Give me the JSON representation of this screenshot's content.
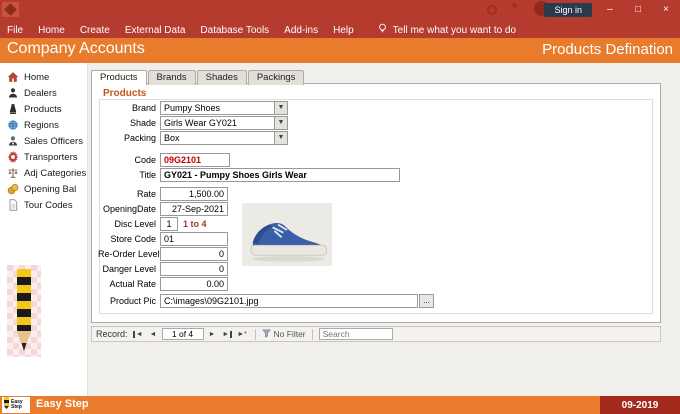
{
  "colors": {
    "titlebar": "#b43b2d",
    "accent_orange": "#e87c2c",
    "dark_red": "#a32b1d",
    "code_red": "#c00000"
  },
  "titlebar": {
    "menus": [
      "File",
      "Home",
      "Create",
      "External Data",
      "Database Tools",
      "Add-ins",
      "Help"
    ],
    "tell_me": "Tell me what you want to do",
    "sign_in": "Sign in",
    "controls": {
      "minimize": "–",
      "maximize": "□",
      "close": "×"
    }
  },
  "header": {
    "title": "Company Accounts",
    "subtitle": "Products Defination"
  },
  "sidebar": {
    "items": [
      {
        "label": "Home"
      },
      {
        "label": "Dealers"
      },
      {
        "label": "Products"
      },
      {
        "label": "Regions"
      },
      {
        "label": "Sales Officers"
      },
      {
        "label": "Transporters"
      },
      {
        "label": "Adj Categories"
      },
      {
        "label": "Opening Bal"
      },
      {
        "label": "Tour Codes"
      }
    ]
  },
  "tabs": [
    {
      "label": "Products"
    },
    {
      "label": "Brands"
    },
    {
      "label": "Shades"
    },
    {
      "label": "Packings"
    }
  ],
  "form": {
    "section_title": "Products",
    "fields": {
      "brand": {
        "label": "Brand",
        "value": "Pumpy Shoes"
      },
      "shade": {
        "label": "Shade",
        "value": "Girls Wear GY021"
      },
      "packing": {
        "label": "Packing",
        "value": "Box"
      },
      "code": {
        "label": "Code",
        "value": "09G2101"
      },
      "title": {
        "label": "Title",
        "value": "GY021 - Pumpy Shoes Girls Wear"
      },
      "rate": {
        "label": "Rate",
        "value": "1,500.00"
      },
      "opening_date": {
        "label": "OpeningDate",
        "value": "27-Sep-2021"
      },
      "disc_level": {
        "label": "Disc Level",
        "value": "1",
        "hint": "1 to 4"
      },
      "store_code": {
        "label": "Store Code",
        "value": "01"
      },
      "reorder_level": {
        "label": "Re-Order Level",
        "value": "0"
      },
      "danger_level": {
        "label": "Danger Level",
        "value": "0"
      },
      "actual_rate": {
        "label": "Actual Rate",
        "value": "0.00"
      },
      "product_pic": {
        "label": "Product Pic",
        "value": "C:\\images\\09G2101.jpg",
        "browse": "..."
      }
    }
  },
  "icons": {
    "dropdown_arrow": "▼"
  },
  "record_nav": {
    "label": "Record:",
    "position": "1 of 4",
    "first": "◄",
    "prev": "◄",
    "next": "►",
    "last": "►",
    "new_record": "►*",
    "filter_label": "No Filter",
    "search_placeholder": "Search"
  },
  "statusbar": {
    "logo_top": "Easy",
    "logo_bottom": "Step",
    "app_name": "Easy Step",
    "period": "09-2019"
  }
}
